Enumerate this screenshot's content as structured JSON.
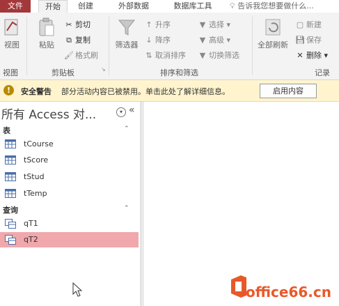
{
  "tabs": [
    "文件",
    "开始",
    "创建",
    "外部数据",
    "数据库工具"
  ],
  "tell_me": "告诉我您想要做什么...",
  "ribbon": {
    "view_label": "视图",
    "paste_label": "粘贴",
    "cut_label": "剪切",
    "copy_label": "复制",
    "format_painter_label": "格式刷",
    "filter_label": "筛选器",
    "asc_label": "升序",
    "desc_label": "降序",
    "remove_sort_label": "取消排序",
    "select_label": "选择",
    "advanced_label": "高级",
    "toggle_filter_label": "切换筛选",
    "refresh_label": "全部刷新",
    "new_label": "新建",
    "save_label": "保存",
    "delete_label": "删除",
    "groups": {
      "views": "视图",
      "clipboard": "剪贴板",
      "sort_filter": "排序和筛选",
      "records": "记录"
    }
  },
  "security": {
    "title": "安全警告",
    "message": "部分活动内容已被禁用。单击此处了解详细信息。",
    "button": "启用内容"
  },
  "nav": {
    "title": "所有 Access 对...",
    "tables_header": "表",
    "tables": [
      "tCourse",
      "tScore",
      "tStud",
      "tTemp"
    ],
    "queries_header": "查询",
    "queries": [
      "qT1",
      "qT2"
    ],
    "selected_query": "qT2"
  },
  "watermark": "office66.cn",
  "colors": {
    "file_tab": "#a4373a",
    "selected_row": "#f0a8ad",
    "security_bar": "#fff4ce"
  }
}
